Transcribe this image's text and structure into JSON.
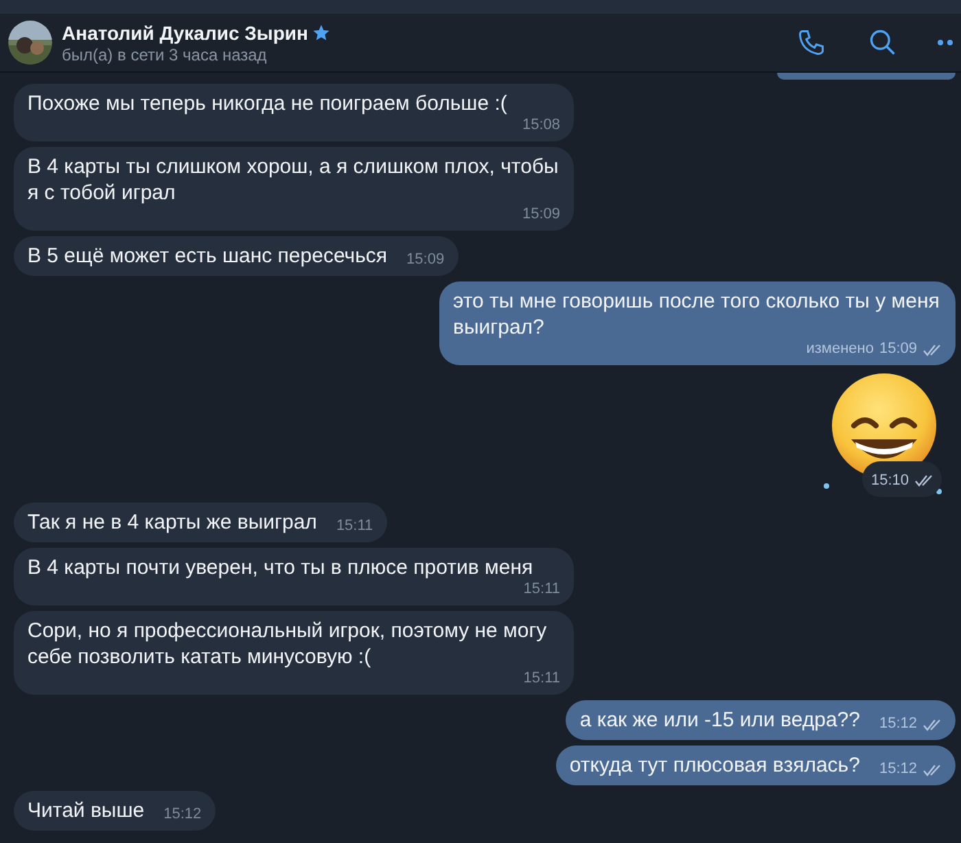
{
  "header": {
    "name": "Анатолий Дукалис Зырин",
    "verified_star": true,
    "status": "был(а) в сети 3 часа назад"
  },
  "messages": [
    {
      "kind": "text",
      "outgoing": false,
      "text": "Похоже мы теперь никогда не поиграем больше :(",
      "time": "15:08"
    },
    {
      "kind": "text",
      "outgoing": false,
      "text": "В 4 карты ты слишком хорош, а я слишком плох, чтобы я с тобой играл",
      "time": "15:09"
    },
    {
      "kind": "text",
      "outgoing": false,
      "text": "В 5 ещё может есть шанс пересечься",
      "time": "15:09"
    },
    {
      "kind": "text",
      "outgoing": true,
      "text": "это ты мне говоришь после того сколько ты у меня выиграл?",
      "edited": "изменено",
      "time": "15:09",
      "read": true
    },
    {
      "kind": "sticker",
      "outgoing": true,
      "time": "15:10",
      "read": true
    },
    {
      "kind": "text",
      "outgoing": false,
      "text": "Так я не в 4 карты же выиграл",
      "time": "15:11"
    },
    {
      "kind": "text",
      "outgoing": false,
      "text": "В 4 карты почти уверен, что ты в плюсе против меня",
      "time": "15:11"
    },
    {
      "kind": "text",
      "outgoing": false,
      "text": "Сори, но я профессиональный игрок, поэтому не могу себе позволить катать минусовую :(",
      "time": "15:11"
    },
    {
      "kind": "text",
      "outgoing": true,
      "text": "а как же или -15 или ведра??",
      "time": "15:12",
      "read": true
    },
    {
      "kind": "text",
      "outgoing": true,
      "text": "откуда тут плюсовая взялась?",
      "time": "15:12",
      "read": true
    },
    {
      "kind": "text",
      "outgoing": false,
      "text": "Читай выше",
      "time": "15:12"
    }
  ]
}
